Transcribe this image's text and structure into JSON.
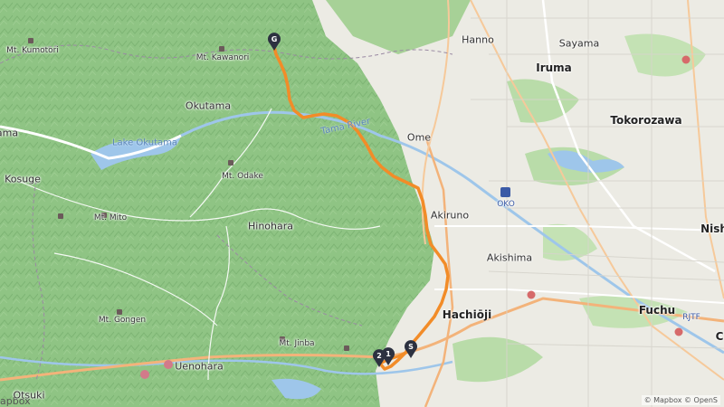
{
  "labels": {
    "hanno": "Hanno",
    "sayama": "Sayama",
    "iruma": "Iruma",
    "tokorozawa": "Tokorozawa",
    "ome": "Ome",
    "akiruno": "Akiruno",
    "oko": "OKO",
    "akishima": "Akishima",
    "hachioji": "Hachiōji",
    "fuchu": "Fuchu",
    "rjtf": "RJTF",
    "nish": "Nish",
    "uenohara": "Uenohara",
    "otsuki": "Otsuki",
    "okutama": "Okutama",
    "kosuge": "Kosuge",
    "hinohara": "Hinohara",
    "mt_kumotori": "Mt. Kumotori",
    "mt_kawanori": "Mt. Kawanori",
    "mt_odake": "Mt. Odake",
    "mt_mito": "Mt. Mito",
    "mt_gongen": "Mt. Gongen",
    "mt_jinba": "Mt. Jinba",
    "lake_okutama": "Lake Okutama",
    "tama_river": "Tama River",
    "c_edge": "C",
    "ama_edge": "ama"
  },
  "markers": {
    "goal": "G",
    "start": "S",
    "waypoint_2": "2",
    "waypoint_1": "1"
  },
  "colors": {
    "route": "#f28c28",
    "forest": "#8fc484",
    "urban": "#e8e6df",
    "water": "#9ec6ea",
    "road_major": "#f3b37a",
    "marker": "#2c3140"
  },
  "attribution": "© Mapbox © OpenS",
  "logo": "apbox"
}
